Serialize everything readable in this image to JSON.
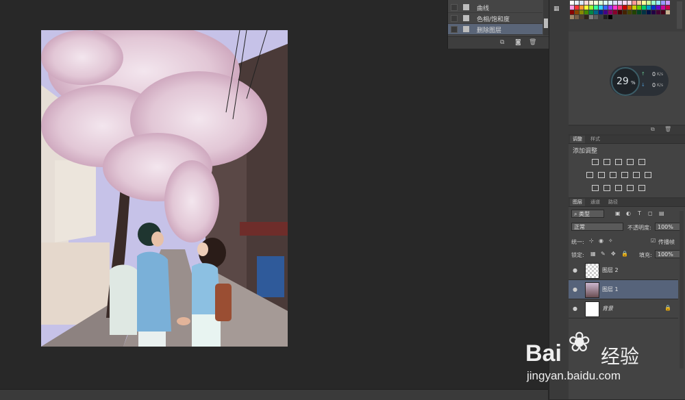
{
  "history": {
    "items": [
      {
        "label": "曲线",
        "selected": false
      },
      {
        "label": "色相/饱和度",
        "selected": false
      },
      {
        "label": "删除图层",
        "selected": true
      }
    ]
  },
  "swatches": {
    "colors": [
      "#ffffff",
      "#e5f0ff",
      "#d8e8ff",
      "#ffd9d9",
      "#fff0d9",
      "#ffffd9",
      "#e0ffd9",
      "#d9fff0",
      "#d9f6ff",
      "#d9e0ff",
      "#e8d9ff",
      "#ffd9f5",
      "#ffd9e6",
      "#ff9999",
      "#ffcc99",
      "#ffff99",
      "#ccff99",
      "#99ffcc",
      "#99eaff",
      "#9999ff",
      "#cc99ff",
      "#ff99e6",
      "#ff3333",
      "#ff9933",
      "#ffff33",
      "#99ff33",
      "#33ff99",
      "#33ccff",
      "#3366ff",
      "#9933ff",
      "#ff33cc",
      "#ff3377",
      "#cc0000",
      "#cc6600",
      "#cccc00",
      "#66cc00",
      "#00cc66",
      "#0099cc",
      "#0033cc",
      "#6600cc",
      "#cc0099",
      "#cc0044",
      "#880000",
      "#884400",
      "#888800",
      "#448800",
      "#008844",
      "#006688",
      "#002288",
      "#440088",
      "#880066",
      "#88002c",
      "#440000",
      "#442200",
      "#444400",
      "#224400",
      "#004422",
      "#003344",
      "#001144",
      "#220044",
      "#440033",
      "#440016",
      "#c8b090",
      "#a08868",
      "#786048",
      "#504030",
      "#302418",
      "#7f7f7f",
      "#5f5f5f",
      "#3f3f3f",
      "#1f1f1f",
      "#000000"
    ]
  },
  "monitor": {
    "percent": "29",
    "unit": "%",
    "up_value": "0",
    "up_unit": "K/s",
    "down_value": "0",
    "down_unit": "K/s"
  },
  "adjustments": {
    "tabs": [
      "调整",
      "样式"
    ],
    "title": "添加调整"
  },
  "layers": {
    "tabs": [
      "图层",
      "通道",
      "路径"
    ],
    "filter_label": "类型",
    "blend_mode": "正常",
    "opacity_label": "不透明度:",
    "opacity_value": "100%",
    "unify_label": "统一:",
    "propagate_label": "传播帧",
    "propagate_value": "1",
    "lock_label": "锁定:",
    "fill_label": "填充:",
    "fill_value": "100%",
    "items": [
      {
        "name": "图层 2",
        "selected": false
      },
      {
        "name": "图层 1",
        "selected": true
      },
      {
        "name": "背景",
        "selected": false,
        "locked": true
      }
    ]
  },
  "watermark": {
    "brand": "Bai",
    "brand_cn": "经验",
    "url": "jingyan.baidu.com"
  }
}
